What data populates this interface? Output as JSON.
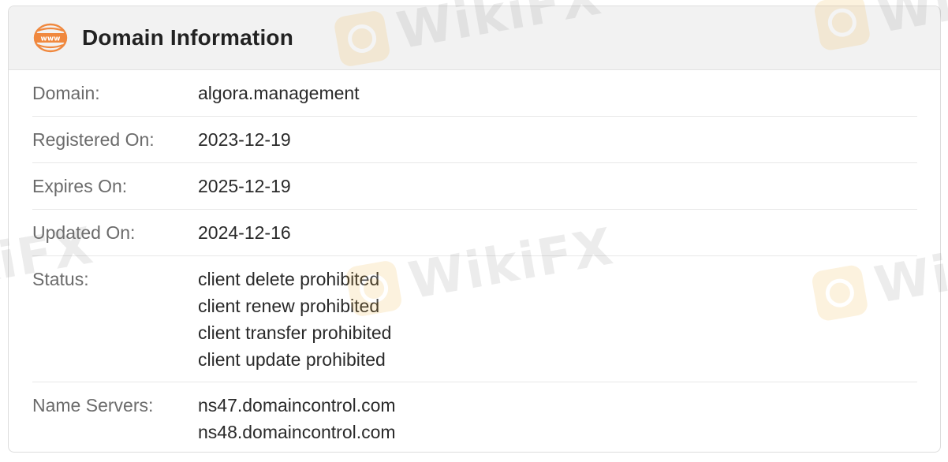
{
  "card": {
    "title": "Domain Information",
    "icon": "www-globe-icon"
  },
  "rows": [
    {
      "label": "Domain:",
      "values": [
        "algora.management"
      ]
    },
    {
      "label": "Registered On:",
      "values": [
        "2023-12-19"
      ]
    },
    {
      "label": "Expires On:",
      "values": [
        "2025-12-19"
      ]
    },
    {
      "label": "Updated On:",
      "values": [
        "2024-12-16"
      ]
    },
    {
      "label": "Status:",
      "values": [
        "client delete prohibited",
        "client renew prohibited",
        "client transfer prohibited",
        "client update prohibited"
      ]
    },
    {
      "label": "Name Servers:",
      "values": [
        "ns47.domaincontrol.com",
        "ns48.domaincontrol.com"
      ]
    }
  ],
  "colors": {
    "accent": "#f0883e",
    "header_bg": "#f2f2f2"
  }
}
